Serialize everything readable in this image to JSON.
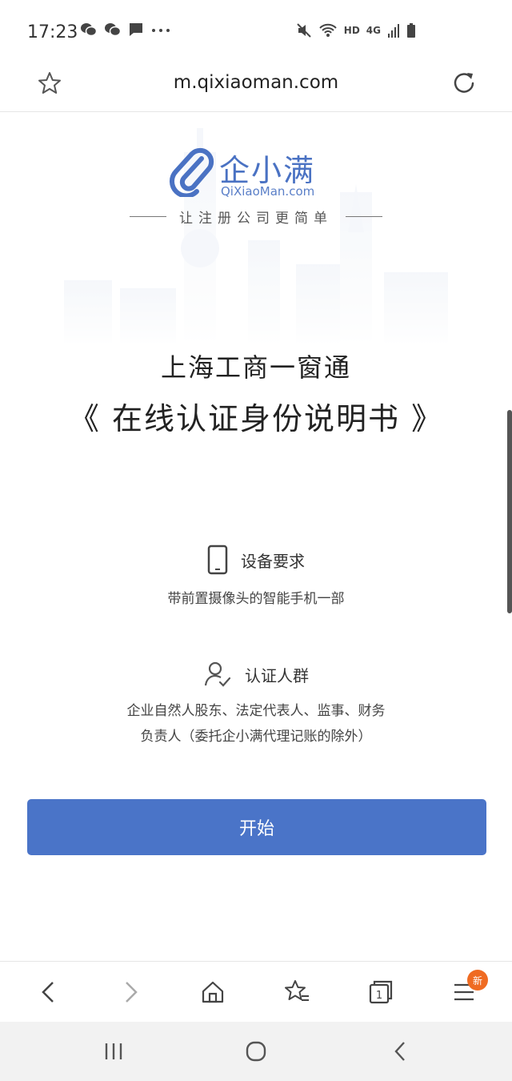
{
  "status_bar": {
    "time": "17:23",
    "network_label": "HD",
    "cell_label": "4G"
  },
  "browser": {
    "url": "m.qixiaoman.com"
  },
  "page": {
    "logo_cn": "企小满",
    "logo_en": "QiXiaoMan.com",
    "slogan": "让注册公司更简单",
    "title_line1": "上海工商一窗通",
    "title_line2": "《 在线认证身份说明书 》",
    "device_req_title": "设备要求",
    "device_req_desc": "带前置摄像头的智能手机一部",
    "auth_group_title": "认证人群",
    "auth_group_desc_line1": "企业自然人股东、法定代表人、监事、财务",
    "auth_group_desc_line2": "负责人（委托企小满代理记账的除外）",
    "start_button": "开始"
  },
  "bottom_nav": {
    "badge": "新",
    "tab_count": "1"
  },
  "colors": {
    "accent": "#4a74c8",
    "badge": "#ef6b22"
  }
}
